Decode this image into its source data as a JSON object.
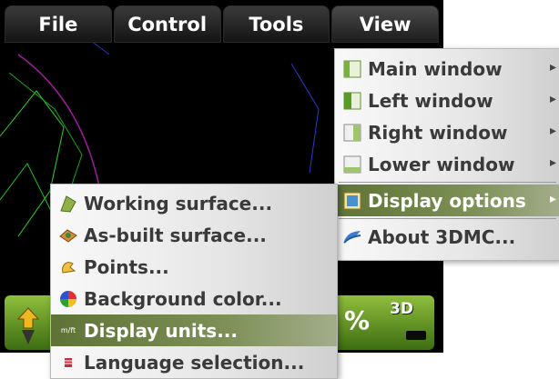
{
  "menubar": {
    "items": [
      {
        "label": "File"
      },
      {
        "label": "Control"
      },
      {
        "label": "Tools"
      },
      {
        "label": "View"
      }
    ]
  },
  "view_menu": {
    "items": [
      {
        "label": "Main window",
        "icon": "main-window-icon",
        "submenu": true
      },
      {
        "label": "Left window",
        "icon": "left-window-icon",
        "submenu": true
      },
      {
        "label": "Right window",
        "icon": "right-window-icon",
        "submenu": true
      },
      {
        "label": "Lower window",
        "icon": "lower-window-icon",
        "submenu": true
      },
      {
        "label": "Display options",
        "icon": "display-options-icon",
        "submenu": true,
        "highlighted": true
      },
      {
        "label": "About 3DMC...",
        "icon": "about-icon",
        "submenu": false
      }
    ]
  },
  "display_options_menu": {
    "items": [
      {
        "label": "Working surface...",
        "icon": "working-surface-icon"
      },
      {
        "label": "As-built surface...",
        "icon": "as-built-surface-icon"
      },
      {
        "label": "Points...",
        "icon": "points-icon"
      },
      {
        "label": "Background color...",
        "icon": "background-color-icon"
      },
      {
        "label": "Display units...",
        "icon": "display-units-icon",
        "highlighted": true,
        "icon_text": "m/ft"
      },
      {
        "label": "Language selection...",
        "icon": "language-selection-icon"
      }
    ]
  },
  "status_bar": {
    "percent_label": "%",
    "mode_label": "3D"
  },
  "colors": {
    "menubar_bg": "#1c1c1c",
    "highlight": "#6f8244",
    "status_bar": "#5e9125"
  }
}
